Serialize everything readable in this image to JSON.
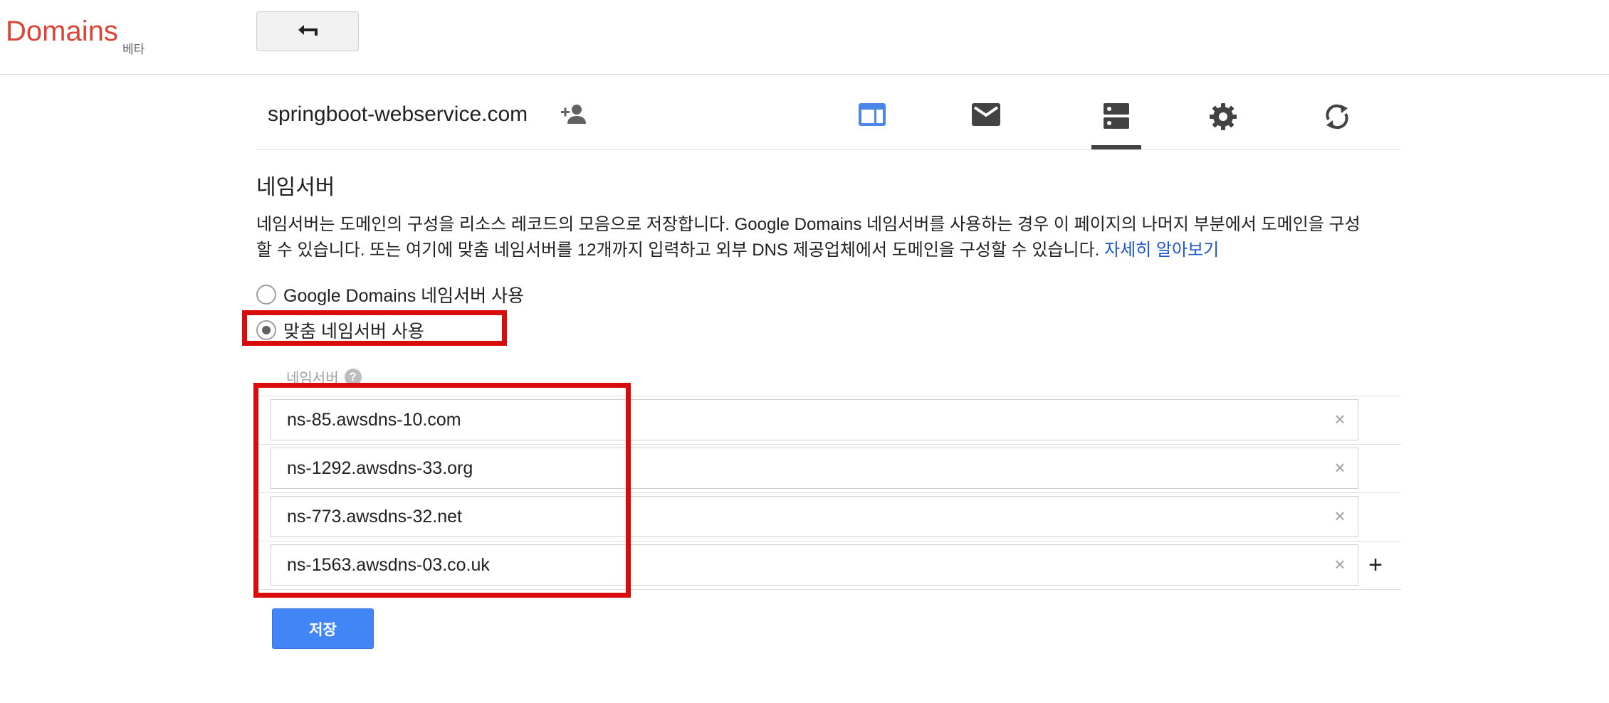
{
  "header": {
    "brand": "Domains",
    "beta": "베타",
    "back_icon": "arrow-back-icon"
  },
  "domain": {
    "name": "springboot-webservice.com",
    "add_user_icon": "person-add-icon"
  },
  "tabs": [
    {
      "icon": "website-icon",
      "active": false,
      "color": "#4a86e8"
    },
    {
      "icon": "email-icon",
      "active": false,
      "color": "#424242"
    },
    {
      "icon": "dns-icon",
      "active": true,
      "color": "#424242"
    },
    {
      "icon": "settings-gear-icon",
      "active": false,
      "color": "#424242"
    },
    {
      "icon": "sync-icon",
      "active": false,
      "color": "#424242"
    }
  ],
  "section": {
    "title": "네임서버",
    "description_line1": "네임서버는 도메인의 구성을 리소스 레코드의 모음으로 저장합니다. Google Domains 네임서버를 사용하는 경우 이 페이지의 나머지 부분에서 도메인을 구성",
    "description_line2": "할 수 있습니다. 또는 여기에 맞춤 네임서버를 12개까지 입력하고 외부 DNS 제공업체에서 도메인을 구성할 수 있습니다. ",
    "learn_more": "자세히 알아보기"
  },
  "options": {
    "google": {
      "label": "Google Domains 네임서버 사용",
      "checked": false
    },
    "custom": {
      "label": "맞춤 네임서버 사용",
      "checked": true
    }
  },
  "nameservers": {
    "header": "네임서버",
    "help": "?",
    "items": [
      "ns-85.awsdns-10.com",
      "ns-1292.awsdns-33.org",
      "ns-773.awsdns-32.net",
      "ns-1563.awsdns-03.co.uk"
    ],
    "clear": "×",
    "add": "+"
  },
  "save_label": "저장",
  "colors": {
    "brand": "#db4437",
    "primary_button": "#4285f4",
    "link": "#1a56c8",
    "annotation": "#d80c0c"
  }
}
